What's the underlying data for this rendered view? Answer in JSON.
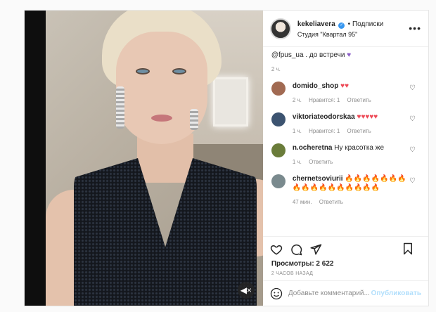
{
  "post": {
    "username": "kekeliavera",
    "follow_label": "Подписки",
    "location": "Студия \"Квартал 95\"",
    "more_icon": "more-horizontal-icon",
    "caption_tail": "@fpus_ua . до встречи",
    "caption_time": "2 ч."
  },
  "comments": [
    {
      "user": "domido_shop",
      "text": "",
      "time": "2 ч.",
      "likes": "Нравится: 1",
      "reply": "Ответить",
      "reaction_text": "♥♥",
      "avatar": "#a16a52"
    },
    {
      "user": "viktoriateodorskaa",
      "text": "",
      "time": "1 ч.",
      "likes": "Нравится: 1",
      "reply": "Ответить",
      "reaction_text": "♥♥♥♥♥",
      "avatar": "#3c5370"
    },
    {
      "user": "n.ocheretna",
      "text": "Ну красотка же",
      "time": "1 ч.",
      "likes": "",
      "reply": "Ответить",
      "reaction_text": "",
      "avatar": "#6a7c3a"
    },
    {
      "user": "chernetsoviurii",
      "text": "",
      "time": "47 мин.",
      "likes": "",
      "reply": "Ответить",
      "reaction_text": "🔥🔥🔥🔥🔥🔥🔥🔥🔥🔥🔥🔥🔥🔥🔥🔥🔥",
      "avatar": "#7a8a8e"
    }
  ],
  "stats": {
    "views": "Просмотры: 2 622",
    "posted": "2 ЧАСОВ НАЗАД"
  },
  "composer": {
    "placeholder": "Добавьте комментарий...",
    "publish_label": "Опубликовать",
    "emoji_icon": "smile-icon"
  },
  "colors": {
    "accent": "#3897f0",
    "heart": "#ed4956"
  }
}
